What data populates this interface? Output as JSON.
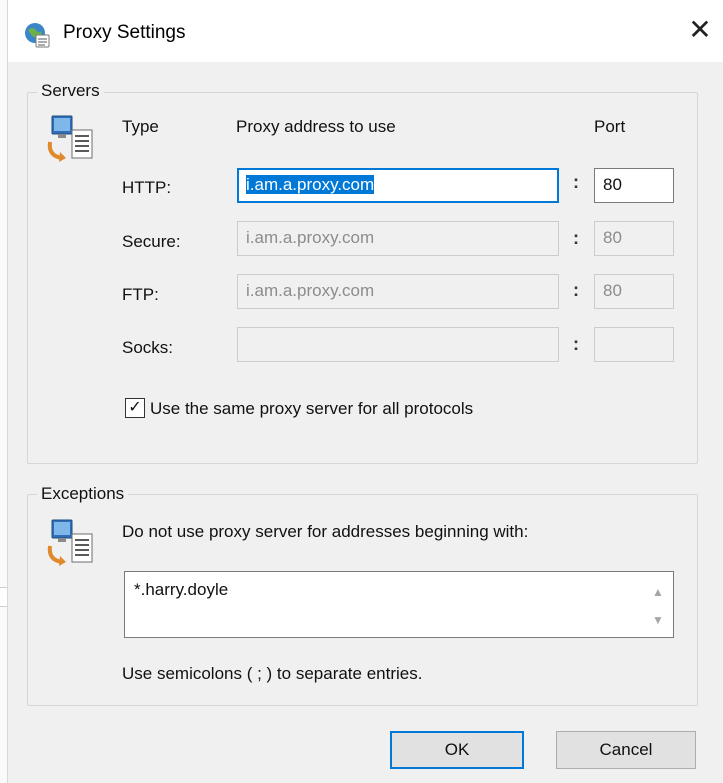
{
  "window": {
    "title": "Proxy Settings",
    "close_glyph": "✕",
    "title_icon": "globe-settings-icon"
  },
  "servers": {
    "legend": "Servers",
    "icon": "network-computer-icon",
    "col_type": "Type",
    "col_address": "Proxy address to use",
    "col_port": "Port",
    "separator": ":",
    "rows": [
      {
        "type": "HTTP:",
        "address": "i.am.a.proxy.com",
        "port": "80"
      },
      {
        "type": "Secure:",
        "address": "i.am.a.proxy.com",
        "port": "80"
      },
      {
        "type": "FTP:",
        "address": "i.am.a.proxy.com",
        "port": "80"
      },
      {
        "type": "Socks:",
        "address": "",
        "port": ""
      }
    ],
    "same_proxy_label": "Use the same proxy server for all protocols",
    "same_proxy_checked": true,
    "check_glyph": "✓"
  },
  "exceptions": {
    "legend": "Exceptions",
    "icon": "network-computer-icon",
    "description": "Do not use proxy server for addresses beginning with:",
    "value": "*.harry.doyle",
    "hint": "Use semicolons ( ; ) to separate entries.",
    "scroll_up_glyph": "▲",
    "scroll_down_glyph": "▼"
  },
  "buttons": {
    "ok": "OK",
    "cancel": "Cancel"
  },
  "colors": {
    "accent": "#0078d7",
    "background": "#f0f0f0"
  }
}
